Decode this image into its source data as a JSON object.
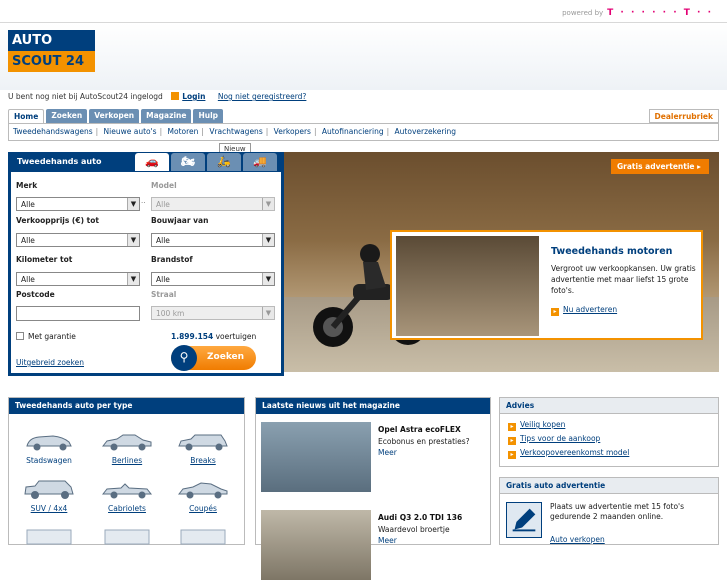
{
  "topbar": {
    "powered_by": "powered by",
    "telekom": "T · · · · · · T · ·"
  },
  "logo": {
    "line1": "AUTO",
    "line2": "SCOUT 24"
  },
  "login": {
    "status": "U bent nog niet bij AutoScout24 ingelogd",
    "login_label": "Login",
    "register_label": "Nog niet geregistreerd?"
  },
  "tabs": [
    "Home",
    "Zoeken",
    "Verkopen",
    "Magazine",
    "Hulp"
  ],
  "dealer": "Dealerrubriek",
  "subnav": [
    "Tweedehandswagens",
    "Nieuwe auto's",
    "Motoren",
    "Vrachtwagens",
    "Verkopers",
    "Autofinanciering",
    "Autoverzekering"
  ],
  "search": {
    "title": "Tweedehands auto",
    "nieuw": "Nieuw",
    "merk_label": "Merk",
    "merk_value": "Alle",
    "model_label": "Model",
    "model_value": "Alle",
    "prijs_label": "Verkoopprijs (€) tot",
    "prijs_value": "Alle",
    "bouwjaar_label": "Bouwjaar van",
    "bouwjaar_value": "Alle",
    "km_label": "Kilometer tot",
    "km_value": "Alle",
    "brandstof_label": "Brandstof",
    "brandstof_value": "Alle",
    "postcode_label": "Postcode",
    "postcode_value": "",
    "straal_label": "Straal",
    "straal_value": "100 km",
    "garantie_label": "Met garantie",
    "count": "1.899.154",
    "count_suffix": " voertuigen",
    "zoeken_label": "Zoeken",
    "uitgebreid_label": "Uitgebreid zoeken"
  },
  "hero": {
    "gratis_label": "Gratis advertentie"
  },
  "promo": {
    "title": "Tweedehands motoren",
    "text": "Vergroot uw verkoopkansen. Uw gratis advertentie met maar liefst 15 grote foto's.",
    "link": "Nu adverteren"
  },
  "types": {
    "title": "Tweedehands auto per type",
    "items": [
      "Stadswagen",
      "Berlines",
      "Breaks",
      "SUV / 4x4",
      "Cabriolets",
      "Coupés"
    ]
  },
  "news": {
    "title": "Laatste nieuws uit het magazine",
    "items": [
      {
        "title": "Opel Astra ecoFLEX",
        "text": "Ecobonus en prestaties?",
        "more": "Meer"
      },
      {
        "title": "Audi Q3 2.0 TDI 136",
        "text": "Waardevol broertje",
        "more": "Meer"
      }
    ]
  },
  "advies": {
    "title": "Advies",
    "links": [
      "Veilig kopen",
      "Tips voor de aankoop",
      "Verkoopovereenkomst model"
    ]
  },
  "gratisadv": {
    "title": "Gratis auto advertentie",
    "text": "Plaats uw advertentie met 15 foto's gedurende 2 maanden online.",
    "link": "Auto verkopen"
  },
  "colors": {
    "brand_blue": "#003f7d",
    "brand_orange": "#f39200"
  }
}
